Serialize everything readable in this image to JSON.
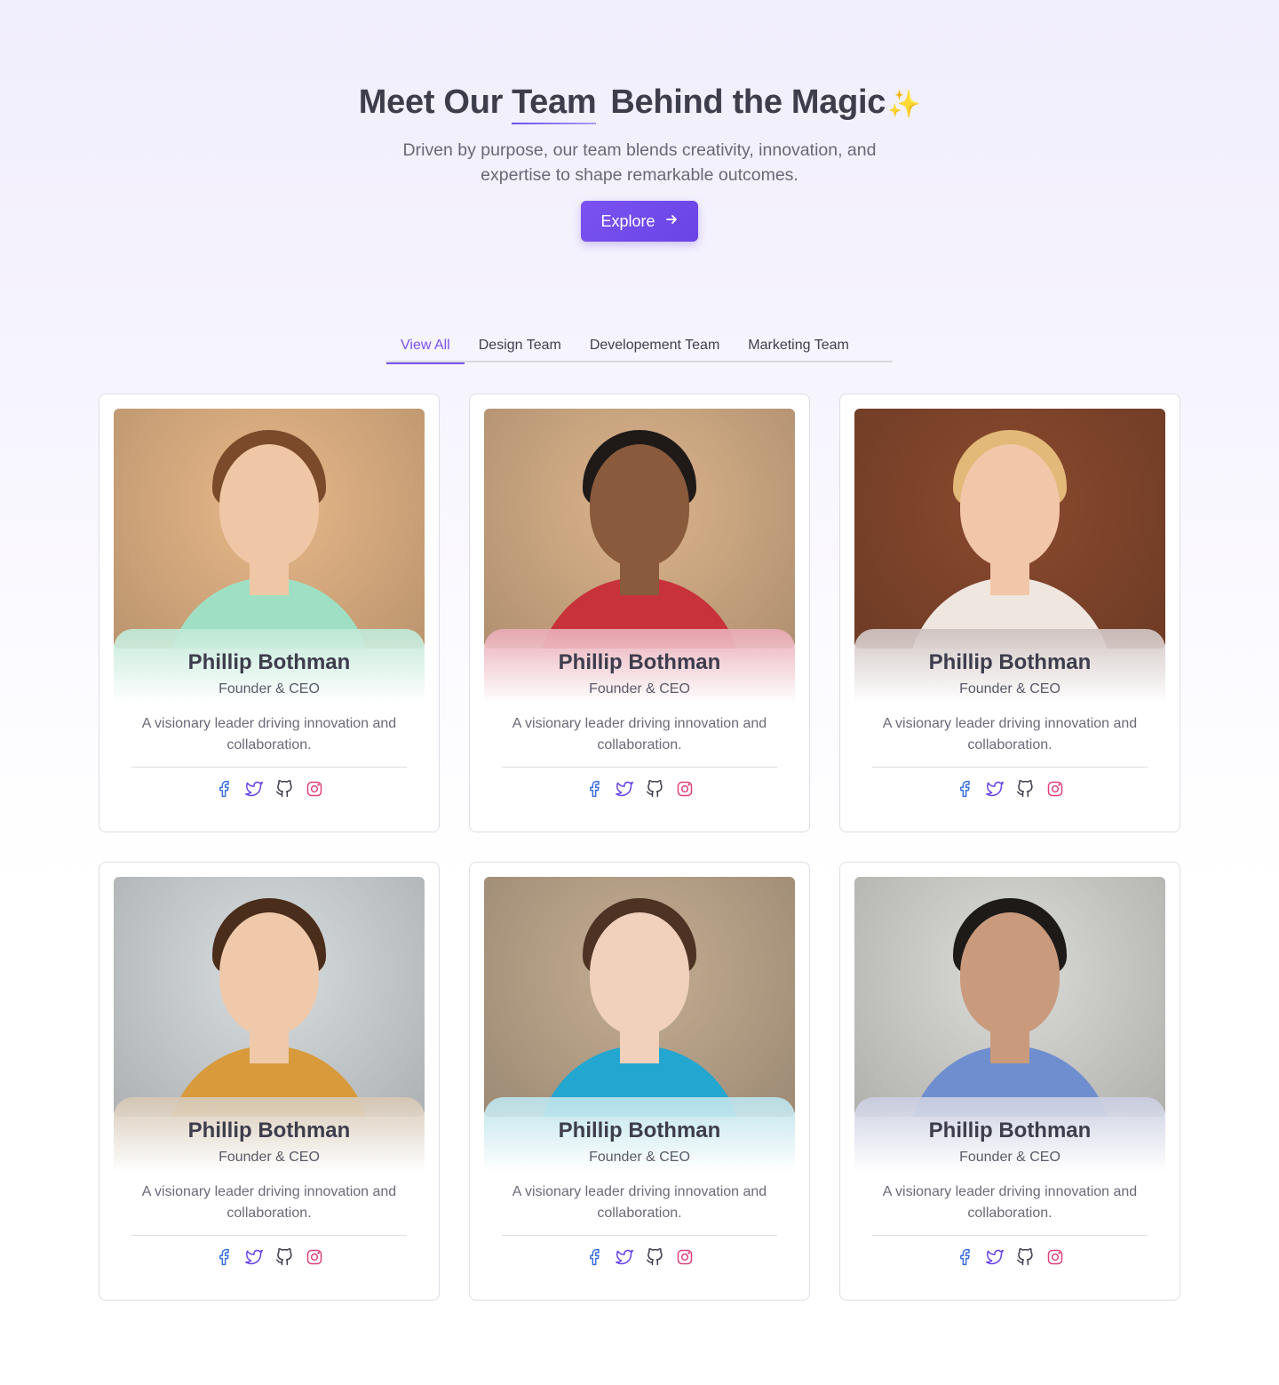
{
  "hero": {
    "title_start": "Meet Our",
    "title_accent": "Team",
    "title_end": "Behind the Magic",
    "sparkle": "✨",
    "subtitle": "Driven by purpose, our team blends creativity, innovation, and expertise to shape remarkable outcomes.",
    "explore_label": "Explore",
    "explore_icon": "arrow-right-icon",
    "accent_color": "#7a52f2"
  },
  "tabs": [
    {
      "label": "View All",
      "active": true
    },
    {
      "label": "Design Team",
      "active": false
    },
    {
      "label": "Developement Team",
      "active": false
    },
    {
      "label": "Marketing Team",
      "active": false
    }
  ],
  "members": [
    {
      "name": "Phillip Bothman",
      "role": "Founder & CEO",
      "description": "A visionary leader driving innovation and collaboration.",
      "tint": "#bfe8d6",
      "photo_bg": "#e9b98a",
      "shirt": "#9fe0c4",
      "skin": "#f0c7a6",
      "hair": "#7a4a2a"
    },
    {
      "name": "Phillip Bothman",
      "role": "Founder & CEO",
      "description": "A visionary leader driving innovation and collaboration.",
      "tint": "#e8a9b4",
      "photo_bg": "#dcb48c",
      "shirt": "#c8323a",
      "skin": "#8a5a3c",
      "hair": "#1f1a18"
    },
    {
      "name": "Phillip Bothman",
      "role": "Founder & CEO",
      "description": "A visionary leader driving innovation and collaboration.",
      "tint": "#cfc2c0",
      "photo_bg": "#8a4a2e",
      "shirt": "#efe6df",
      "skin": "#f2c6a8",
      "hair": "#e2b978"
    },
    {
      "name": "Phillip Bothman",
      "role": "Founder & CEO",
      "description": "A visionary leader driving innovation and collaboration.",
      "tint": "#d6c7b4",
      "photo_bg": "#d8dde0",
      "shirt": "#d89a3a",
      "skin": "#efc9aa",
      "hair": "#4a2d1a"
    },
    {
      "name": "Phillip Bothman",
      "role": "Founder & CEO",
      "description": "A visionary leader driving innovation and collaboration.",
      "tint": "#b9e2ea",
      "photo_bg": "#c4ad92",
      "shirt": "#23a6d0",
      "skin": "#f1d0bc",
      "hair": "#4e3224"
    },
    {
      "name": "Phillip Bothman",
      "role": "Founder & CEO",
      "description": "A visionary leader driving innovation and collaboration.",
      "tint": "#c9cde0",
      "photo_bg": "#dcdcd8",
      "shirt": "#6f8ed0",
      "skin": "#c99a7c",
      "hair": "#1d1a18"
    }
  ],
  "socials": [
    {
      "icon": "facebook-icon",
      "color": "#3b6fe0"
    },
    {
      "icon": "twitter-icon",
      "color": "#6a44e6"
    },
    {
      "icon": "github-icon",
      "color": "#3d3d4c"
    },
    {
      "icon": "instagram-icon",
      "color": "#e0407a"
    }
  ]
}
